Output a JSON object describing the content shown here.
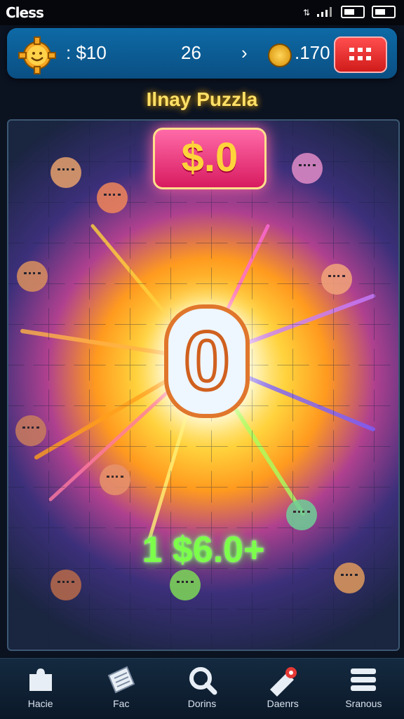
{
  "status": {
    "carrier": "Cless"
  },
  "header": {
    "score": "$10",
    "level": "26",
    "coins": ".170",
    "colors": {
      "bar": "#0e6aa6",
      "menu": "#e62b2b"
    }
  },
  "game": {
    "title": "Ilnay Puzzla",
    "top_score": "$.0",
    "center_number": "0",
    "bonus": "1 $6.0+",
    "colors": {
      "title": "#ffe066",
      "bonus": "#7cff4a"
    }
  },
  "nav": {
    "items": [
      {
        "label": "Hacie",
        "icon": "puzzle-piece-icon"
      },
      {
        "label": "Fac",
        "icon": "ticket-icon"
      },
      {
        "label": "Dorins",
        "icon": "search-icon"
      },
      {
        "label": "Daenrs",
        "icon": "boost-icon"
      },
      {
        "label": "Sranous",
        "icon": "menu-icon"
      }
    ]
  }
}
